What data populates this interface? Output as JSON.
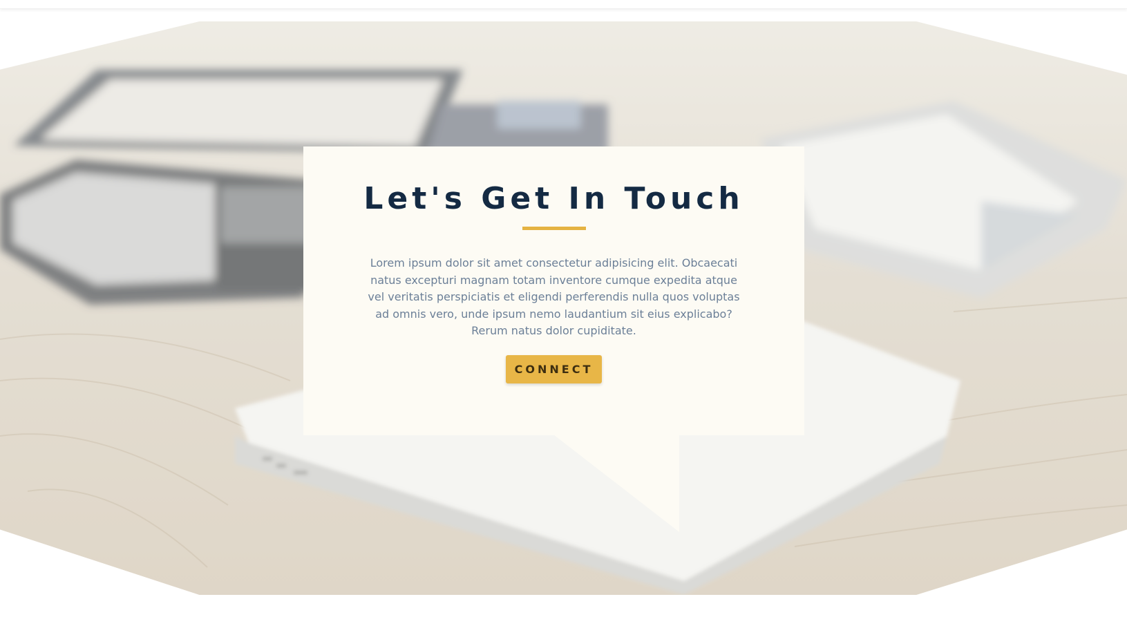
{
  "hero": {
    "image_icon": "desk-devices-photo"
  },
  "contact": {
    "title": "Let's Get In Touch",
    "description": "Lorem ipsum dolor sit amet consectetur adipisicing elit. Obcaecati natus excepturi magnam totam inventore cumque expedita atque vel veritatis perspiciatis et eligendi perferendis nulla quos voluptas ad omnis vero, unde ipsum nemo laudantium sit eius explicabo? Rerum natus dolor cupiditate.",
    "button_label": "CONNECT"
  },
  "colors": {
    "accent": "#e8b647",
    "title": "#142a43",
    "text": "#6b7f97",
    "card": "#fdfbf4"
  }
}
